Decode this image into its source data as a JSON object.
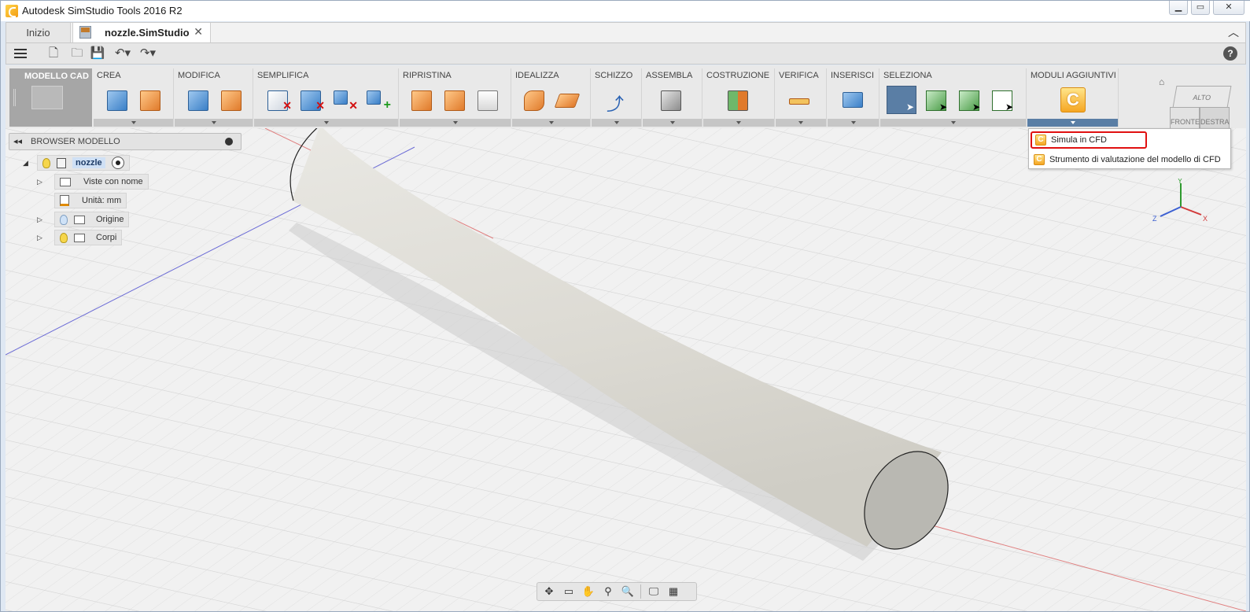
{
  "window": {
    "title": "Autodesk SimStudio Tools 2016 R2"
  },
  "tabs": {
    "home": "Inizio",
    "document": "nozzle.SimStudio"
  },
  "ribbon": {
    "workspace": "MODELLO CAD",
    "panels": {
      "crea": "CREA",
      "modifica": "MODIFICA",
      "semplifica": "SEMPLIFICA",
      "ripristina": "RIPRISTINA",
      "idealizza": "IDEALIZZA",
      "schizzo": "SCHIZZO",
      "assembla": "ASSEMBLA",
      "costruzione": "COSTRUZIONE",
      "verifica": "VERIFICA",
      "inserisci": "INSERISCI",
      "seleziona": "SELEZIONA",
      "moduli": "MODULI AGGIUNTIVI"
    },
    "cfd_icon_letter": "C"
  },
  "browser": {
    "title": "BROWSER MODELLO",
    "root": "nozzle",
    "items": {
      "named_views": "Viste con nome",
      "units": "Unità: mm",
      "origin": "Origine",
      "bodies": "Corpi"
    }
  },
  "dropdown": {
    "items": {
      "simulate": "Simula in CFD",
      "evaluate": "Strumento di valutazione del modello di CFD"
    }
  },
  "viewcube": {
    "top": "ALTO",
    "front": "FRONTE",
    "right": "DESTRA"
  },
  "triad": {
    "x": "X",
    "y": "Y",
    "z": "Z"
  },
  "colors": {
    "accent": "#5a7ea5",
    "highlight": "#e01010",
    "cfd": "#f5a623"
  }
}
